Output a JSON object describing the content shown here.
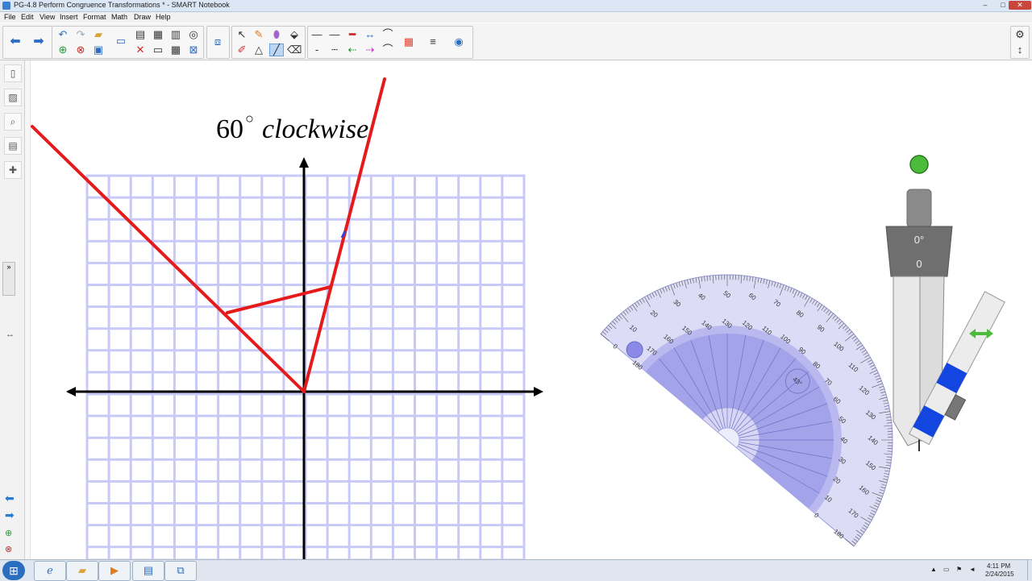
{
  "window": {
    "title": "PG-4.8 Perform Congruence Transformations * - SMART Notebook",
    "controls": {
      "minimize": "–",
      "maximize": "□",
      "close": "✕"
    }
  },
  "menu": [
    "File",
    "Edit",
    "View",
    "Insert",
    "Format",
    "Math",
    "Draw",
    "Help"
  ],
  "toolbar": {
    "back_icon": "arrow-left-icon",
    "forward_icon": "arrow-right-icon",
    "right_controls": {
      "settings": "⚙",
      "move": "↕"
    }
  },
  "sidebar": {
    "tabs": [
      "page-sorter",
      "gallery",
      "attachments",
      "properties",
      "add-ons"
    ],
    "collapse": "↔"
  },
  "canvas": {
    "annotation": {
      "number": "60",
      "degree": "○",
      "text": "clockwise"
    },
    "protractor": {
      "outer_scale": [
        "0",
        "10",
        "20",
        "30",
        "40",
        "50",
        "60",
        "70",
        "80",
        "90",
        "100",
        "110",
        "120",
        "130",
        "140",
        "150",
        "160",
        "170",
        "180"
      ],
      "inner_scale": [
        "180",
        "170",
        "160",
        "150",
        "140",
        "130",
        "120",
        "110",
        "100",
        "90",
        "80",
        "70",
        "60",
        "50",
        "40",
        "30",
        "20",
        "10",
        "0"
      ],
      "angle_readout": "43°"
    },
    "compass": {
      "angle": "0°",
      "radius": "0"
    },
    "colors": {
      "grid": "#c9c9f8",
      "line": "#e51a1a",
      "axis": "#000000"
    }
  },
  "taskbar": {
    "clock_time": "4:11 PM",
    "clock_date": "2/24/2015"
  }
}
